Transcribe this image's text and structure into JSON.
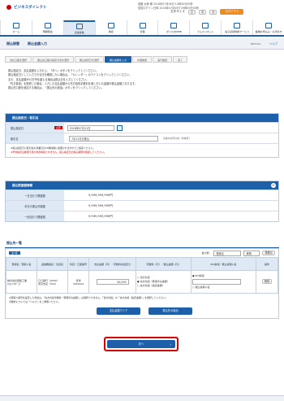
{
  "header": {
    "brand": "ビジネスダイレクト",
    "user_info": "愛媛 太郎 様 2016年07月06日 12時30分00秒",
    "last_login": "前回ログイン日時 2016年07月05日 09時00分00秒",
    "font_label": "文字サイズ",
    "font_s": "小",
    "font_m": "中",
    "font_l": "大",
    "logout": "ログアウト"
  },
  "nav": [
    "ホーム",
    "明細照会",
    "資金移動",
    "承認",
    "管理",
    "がいためWEB",
    "でんさいネット",
    "電子記録債権サービス",
    "各種お申込み・お手続き"
  ],
  "page": {
    "section": "振込振替",
    "title": "振込金額入力",
    "code": "BFKF011",
    "help": "ヘルプ"
  },
  "steps": [
    "支払口座を選択",
    "振込先口座の指定方法を選択",
    "振込指定日を選択",
    "振込金額を入力",
    "内容確認",
    "実行確認",
    "完了"
  ],
  "intro": [
    "振込指定日、支払金額を入力の上、「次へ」ボタンをクリックしてください。",
    "振込指定日として入力できる日を確認したい場合は、「カレンダー」のアイコンをクリックしてください。",
    "また、支払金額が10万円を超える場合は振込日を入力してください。",
    "「先方負担」を選択した場合、入力した支払金額から先方負担手数料を差し引いた金額が振込金額となります。",
    "振込先口座を追加する場合は、「振込先の追加」ボタンをクリックしてください。"
  ],
  "date_section": {
    "heading": "振込指定日・取引名",
    "date_label": "振込指定日",
    "required": "必須",
    "date_value": "2016年07月11日",
    "name_label": "取引名",
    "name_value": "7月11日分振込",
    "name_note": "全角10文字以内［半角可］",
    "note1": "※振込指定日に取引先の営業日の24時間前に処理されますのでご指定ください。",
    "note2": "※予約指定は権限不足の場合承認されません。振込指定日の振込期限を確認してください。"
  },
  "limit_section": {
    "heading": "振込限度額情報",
    "rows": [
      {
        "label": "一日当たり限度額",
        "value": "9,999,999,999円"
      },
      {
        "label": "本日の振込可能額",
        "value": "9,999,999,999円"
      },
      {
        "label": "一回当たり限度額",
        "value": "9,999,999,999円"
      }
    ]
  },
  "payee_section": {
    "heading": "振込先一覧",
    "count_label": "全1件",
    "sort_label": "並び順：",
    "sort_value": "登録名",
    "order_value": "昇順",
    "sort_btn": "再表示",
    "columns": [
      "登録名／受取人名",
      "金融機関名／支店名",
      "科目／口座番号",
      "支払金額（円）／手数料負担区分",
      "手数料（円）／振込金額（円）",
      "EDI情報／振込依頼人名",
      "操作"
    ],
    "row": {
      "name": "株式会社愛媛工業",
      "kana": "ｶ)ｴﾋﾒｺｳｷﾞｮｳ",
      "bank": "〇〇銀行（9999）",
      "branch": "東京支店（444）",
      "account_type": "普通",
      "account_no": "4444444",
      "amount": "90,000",
      "fee_opt1": "当方負担",
      "fee_opt2": "先方負担（登録済み金額）",
      "fee_opt3": "先方負担（指定金額）",
      "edi_opt1": "EDI情報",
      "edi_opt2": "振込依頼人名",
      "action": "削除"
    },
    "note1": "※受取人番号を設定した場合は、「先方負担手数料（登録済み金額）」は選択できません。「当方負担」か「先方負担（指定金額）」を選択してください。",
    "note2": "手数料については「ヘルプ」をご参照ください。",
    "clear_btn": "支払金額クリア",
    "add_btn": "振込先の追加"
  },
  "next_btn": "次へ"
}
